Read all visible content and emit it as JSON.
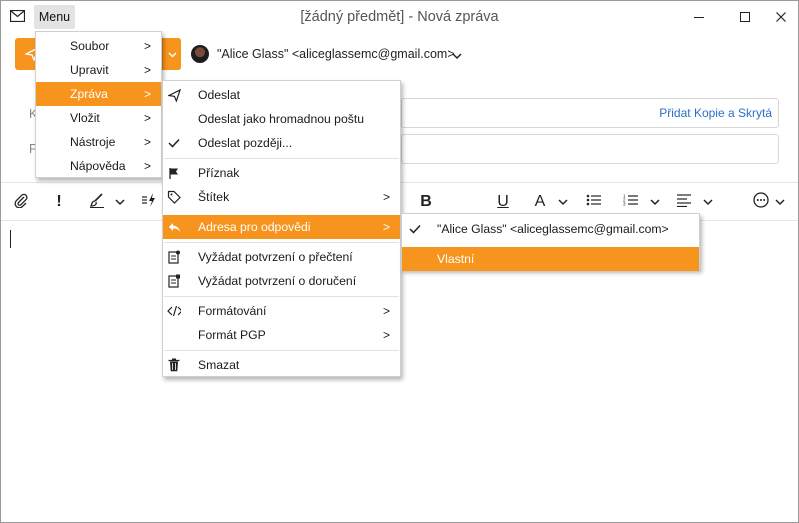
{
  "window": {
    "menu_button": "Menu",
    "title": "[žádný předmět] - Nová zpráva"
  },
  "header": {
    "from": "\"Alice Glass\" <aliceglassemc@gmail.com>",
    "cc_bcc_link": "Přidat Kopie a Skrytá",
    "to_label_visible": "K",
    "subject_label_visible": "P"
  },
  "main_menu": {
    "items": [
      {
        "label": "Soubor"
      },
      {
        "label": "Upravit"
      },
      {
        "label": "Zpráva"
      },
      {
        "label": "Vložit"
      },
      {
        "label": "Nástroje"
      },
      {
        "label": "Nápověda"
      }
    ]
  },
  "message_menu": {
    "items": [
      {
        "label": "Odeslat",
        "icon": "send-icon"
      },
      {
        "label": "Odeslat jako hromadnou poštu"
      },
      {
        "label": "Odeslat později...",
        "icon": "check-icon"
      },
      {
        "label": "Příznak",
        "icon": "flag-icon"
      },
      {
        "label": "Štítek",
        "icon": "tag-icon"
      },
      {
        "label": "Adresa pro odpovědi",
        "icon": "reply-icon"
      },
      {
        "label": "Vyžádat potvrzení o přečtení",
        "icon": "read-receipt-icon"
      },
      {
        "label": "Vyžádat potvrzení o doručení",
        "icon": "delivery-receipt-icon"
      },
      {
        "label": "Formátování",
        "icon": "code-icon"
      },
      {
        "label": "Formát PGP"
      },
      {
        "label": "Smazat",
        "icon": "trash-icon"
      }
    ]
  },
  "reply_to_menu": {
    "items": [
      {
        "label": "\"Alice Glass\" <aliceglassemc@gmail.com>",
        "checked": true
      },
      {
        "label": "Vlastní"
      }
    ]
  },
  "toolbar": {
    "bold": "B",
    "important": "!",
    "underline": "U",
    "font_color": "A"
  },
  "colors": {
    "accent": "#f7941d",
    "link": "#2a6fc9"
  }
}
